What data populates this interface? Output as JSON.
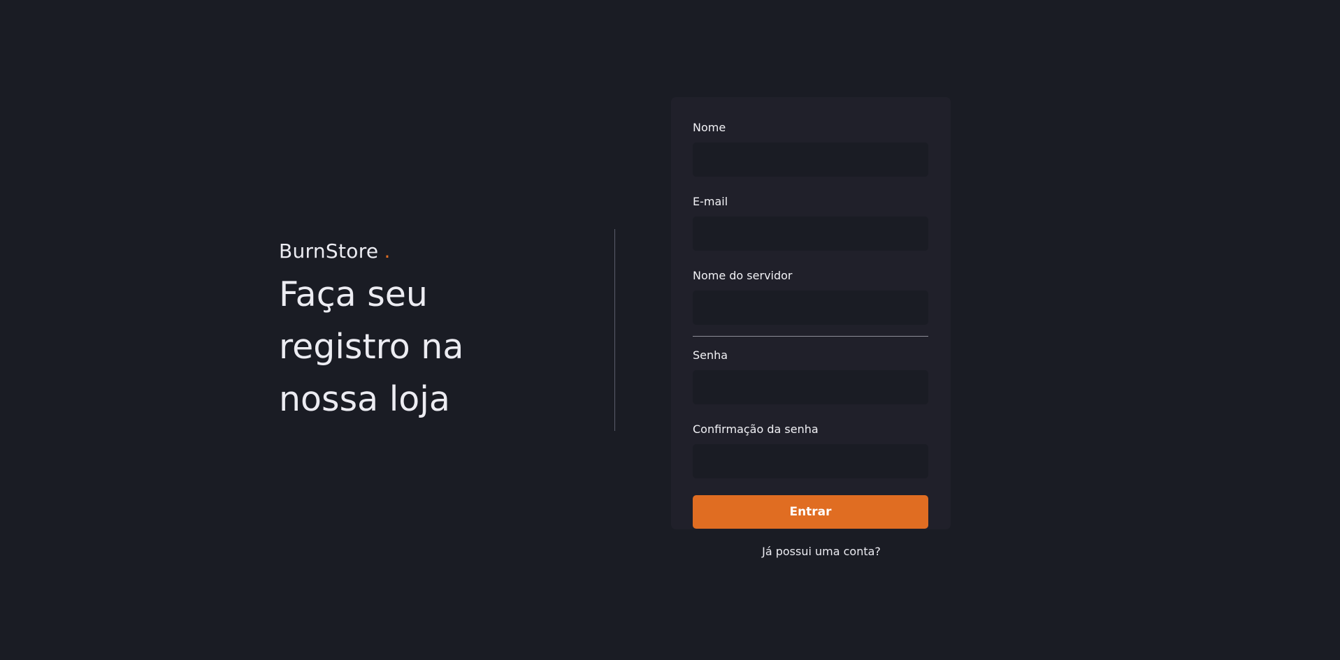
{
  "brand": {
    "name": "BurnStore",
    "dot": "."
  },
  "hero": {
    "headline_lines": [
      "Faça seu",
      "registro na",
      "nossa loja"
    ]
  },
  "form": {
    "fields": [
      {
        "label": "Nome",
        "value": ""
      },
      {
        "label": "E-mail",
        "value": ""
      },
      {
        "label": "Nome do servidor",
        "value": ""
      },
      {
        "label": "Senha",
        "value": ""
      },
      {
        "label": "Confirmação da senha",
        "value": ""
      }
    ],
    "submit_label": "Entrar"
  },
  "footer": {
    "login_link": "Já possui uma conta?"
  },
  "colors": {
    "background": "#1a1c24",
    "card": "#20202a",
    "accent": "#e06d22",
    "text": "#ececf2"
  }
}
